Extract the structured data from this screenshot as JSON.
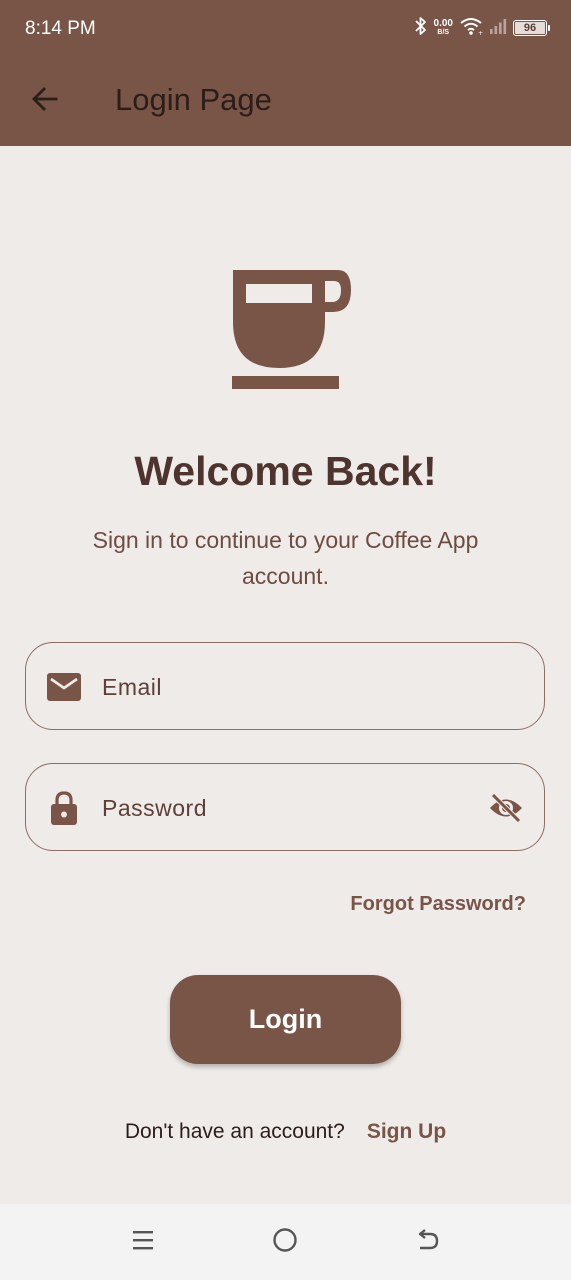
{
  "status_bar": {
    "time": "8:14 PM",
    "net_speed_value": "0.00",
    "net_speed_unit": "B/S",
    "battery_level": "96",
    "icons": [
      "bluetooth-icon",
      "wifi-icon",
      "signal-icon",
      "battery-icon"
    ]
  },
  "app_bar": {
    "title": "Login Page",
    "back_icon": "arrow-left-icon"
  },
  "hero": {
    "logo_icon": "coffee-cup-icon",
    "heading": "Welcome Back!",
    "subtitle": "Sign in to continue to your Coffee App account."
  },
  "form": {
    "email": {
      "placeholder": "Email",
      "value": "",
      "icon": "mail-icon"
    },
    "password": {
      "placeholder": "Password",
      "value": "",
      "icon": "lock-icon",
      "toggle_icon": "eye-off-icon"
    },
    "forgot_password_label": "Forgot Password?",
    "login_label": "Login"
  },
  "footer": {
    "prompt": "Don't have an account?",
    "signup_label": "Sign Up"
  },
  "system_nav": {
    "icons": [
      "menu-icon",
      "home-circle-icon",
      "back-icon"
    ]
  },
  "colors": {
    "primary": "#795548",
    "background": "#efebe9",
    "heading": "#4e342e",
    "subtitle": "#6d4c41",
    "border": "#8d6e63"
  }
}
